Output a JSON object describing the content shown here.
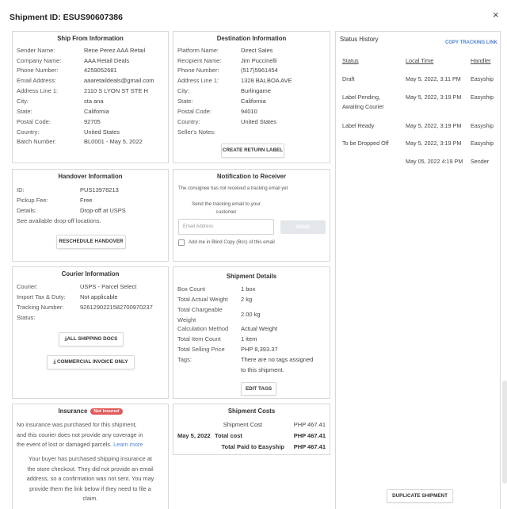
{
  "header": {
    "title": "Shipment ID: ESUS90607386",
    "close": "×"
  },
  "ship_from": {
    "title": "Ship From Information",
    "rows": [
      {
        "k": "Sender Name:",
        "v": "Rene Perez AAA Retail"
      },
      {
        "k": "Company Name:",
        "v": "AAA Retail Deals"
      },
      {
        "k": "Phone Number:",
        "v": "4259052681"
      },
      {
        "k": "Email Address:",
        "v": "aaaretaildeals@gmail.com"
      },
      {
        "k": "Address Line 1:",
        "v": "2110 S LYON ST STE H"
      },
      {
        "k": "City:",
        "v": "sta ana"
      },
      {
        "k": "State:",
        "v": "California"
      },
      {
        "k": "Postal Code:",
        "v": "92705"
      },
      {
        "k": "Country:",
        "v": "United States"
      },
      {
        "k": "Batch Number:",
        "v": "BL0001 - May 5, 2022"
      }
    ]
  },
  "destination": {
    "title": "Destination Information",
    "rows": [
      {
        "k": "Platform Name:",
        "v": "Direct Sales"
      },
      {
        "k": "Recipient Name:",
        "v": "Jim Puccinelli"
      },
      {
        "k": "Phone Number:",
        "v": "(517)5961454"
      },
      {
        "k": "Address Line 1:",
        "v": "1328 BALBOA AVE"
      },
      {
        "k": "City:",
        "v": "Burlingame"
      },
      {
        "k": "State:",
        "v": "California"
      },
      {
        "k": "Postal Code:",
        "v": "94010"
      },
      {
        "k": "Country:",
        "v": "United States"
      },
      {
        "k": "Seller's Notes:",
        "v": ""
      }
    ],
    "button": "CREATE RETURN LABEL"
  },
  "status_history": {
    "title": "Status History",
    "copy_link": "COPY TRACKING LINK",
    "columns": [
      "Status",
      "Local Time",
      "Handler"
    ],
    "rows": [
      {
        "status": "Draft",
        "status2": "",
        "time": "May 5, 2022, 3:11 PM",
        "handler": "Easyship"
      },
      {
        "status": "Label Pending,",
        "status2": "Awaiting Courier",
        "time": "May 5, 2022, 3:19 PM",
        "handler": "Easyship"
      },
      {
        "status": "Label Ready",
        "status2": "",
        "time": "May 5, 2022, 3:19 PM",
        "handler": "Easyship"
      },
      {
        "status": "To be Dropped Off",
        "status2": "",
        "time": "May 5, 2022, 3:19 PM",
        "handler": "Easyship"
      },
      {
        "status": "",
        "status2": "",
        "time": "May 05, 2022 4:19 PM",
        "handler": "Sender"
      }
    ],
    "duplicate_button": "DUPLICATE SHIPMENT"
  },
  "handover": {
    "title": "Handover Information",
    "rows": [
      {
        "k": "ID:",
        "v": "PUS13978213"
      },
      {
        "k": "Pickup Fee:",
        "v": "Free"
      },
      {
        "k": "Details:",
        "v": "Drop-off at USPS"
      }
    ],
    "link": "See available drop-off locations.",
    "button": "RESCHEDULE HANDOVER"
  },
  "notification": {
    "title": "Notification to Receiver",
    "note": "The consignee has not received a tracking email yet",
    "send_text_1": "Send the tracking email to your",
    "send_text_2": "customer",
    "email_placeholder": "Email Address",
    "send_button": "SEND",
    "bcc_label": "Add me in Blind Copy (Bcc) of this email"
  },
  "courier": {
    "title": "Courier Information",
    "rows": [
      {
        "k": "Courier:",
        "v": "USPS - Parcel Select"
      },
      {
        "k": "Import Tax & Duty:",
        "v": "Not applicable"
      },
      {
        "k": "Tracking Number:",
        "v": "9261290221582700970237"
      },
      {
        "k": "Status:",
        "v": ""
      }
    ],
    "docs_button": "ALL SHIPPING DOCS",
    "invoice_button": "COMMERCIAL INVOICE ONLY"
  },
  "shipment_details": {
    "title": "Shipment Details",
    "rows": [
      {
        "k": "Box Count",
        "v": "1 box"
      },
      {
        "k": "Total Actual Weight",
        "v": "2 kg"
      },
      {
        "k": "Total Chargeable",
        "k2": "Weight",
        "v": "2.00 kg"
      },
      {
        "k": "Calculation Method",
        "v": "Actual Weight"
      },
      {
        "k": "Total Item Count",
        "v": "1 item"
      },
      {
        "k": "Total Selling Price",
        "v": "PHP 8,393.37"
      },
      {
        "k": "Tags:",
        "v": "There are no tags assigned",
        "v2": "to this shipment."
      }
    ],
    "button": "EDIT TAGS"
  },
  "insurance": {
    "title": "Insurance",
    "badge": "Not Insured",
    "p1": [
      "No insurance was purchased for this shipment,",
      "and this courier does not provide any coverage in",
      "the event of lost or damaged parcels."
    ],
    "learn_more": "Learn more",
    "p2": [
      "Your buyer has purchased shipping insurance at",
      "the store checkout. They did not provide an email",
      "address, so a confirmation was not sent. You may",
      "provide them the link below if they need to file a",
      "claim."
    ]
  },
  "costs": {
    "title": "Shipment Costs",
    "rows": [
      {
        "date": "",
        "label": "Shipment Cost",
        "value": "PHP 467.41"
      },
      {
        "date": "May 5, 2022",
        "label": "Total cost",
        "value": "PHP 467.41"
      },
      {
        "date": "",
        "label": "Total Paid to Easyship",
        "value": "PHP 467.41"
      }
    ]
  },
  "colors": {
    "accent": "#4a7fd6",
    "badge": "#e25a5a",
    "border": "#d8d8d8"
  }
}
